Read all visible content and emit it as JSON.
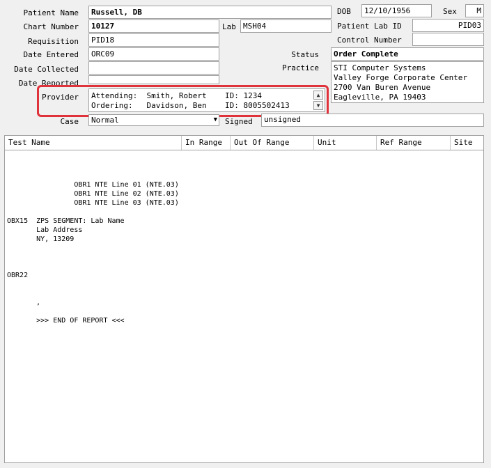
{
  "form": {
    "patient_name_label": "Patient Name",
    "patient_name": "Russell, DB",
    "dob_label": "DOB",
    "dob": "12/10/1956",
    "sex_label": "Sex",
    "sex": "M",
    "chart_number_label": "Chart Number",
    "chart_number": "10127",
    "lab_label": "Lab",
    "lab": "MSH04",
    "patient_lab_id_label": "Patient Lab ID",
    "patient_lab_id": "PID03",
    "requisition_label": "Requisition",
    "requisition": "PID18",
    "control_number_label": "Control Number",
    "control_number": "",
    "date_entered_label": "Date Entered",
    "date_entered": "ORC09",
    "status_label": "Status",
    "status": "Order Complete",
    "date_collected_label": "Date Collected",
    "date_collected": "",
    "practice_label": "Practice",
    "practice_lines": "STI Computer Systems\nValley Forge Corporate Center\n2700 Van Buren Avenue\nEagleville, PA 19403",
    "date_reported_label": "Date Reported",
    "date_reported": "",
    "provider_label": "Provider",
    "provider_attending": "Attending:  Smith, Robert    ID: 1234",
    "provider_ordering": "Ordering:   Davidson, Ben    ID: 8005502413",
    "case_label": "Case",
    "case_value": "Normal",
    "signed_label": "Signed",
    "signed_value": "unsigned"
  },
  "table": {
    "columns": [
      "Test Name",
      "In Range",
      "Out Of Range",
      "Unit",
      "Ref Range",
      "Site"
    ]
  },
  "report_text": "                OBR1 NTE Line 01 (NTE.03)\n                OBR1 NTE Line 02 (NTE.03)\n                OBR1 NTE Line 03 (NTE.03)\n\nOBX15  ZPS SEGMENT: Lab Name\n       Lab Address\n       NY, 13209\n\n\n\nOBR22\n\n\n       ,\n\n       >>> END OF REPORT <<<"
}
